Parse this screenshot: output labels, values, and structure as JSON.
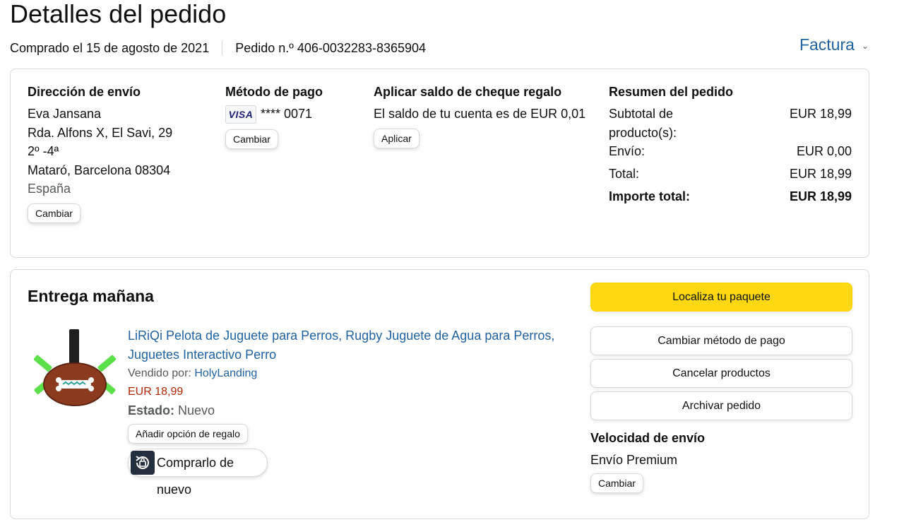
{
  "page": {
    "title": "Detalles del pedido",
    "ordered_on": "Comprado el 15 de agosto de 2021",
    "order_number": "Pedido n.º 406-0032283-8365904",
    "invoice_label": "Factura"
  },
  "shipping_address": {
    "title": "Dirección de envío",
    "lines": [
      "Eva Jansana",
      "Rda. Alfons X, El Savi, 29",
      "2º -4ª",
      "Mataró, Barcelona 08304"
    ],
    "country": "España",
    "change_label": "Cambiar"
  },
  "payment_method": {
    "title": "Método de pago",
    "card_brand": "VISA",
    "card_number": "**** 0071",
    "change_label": "Cambiar"
  },
  "gift_balance": {
    "title": "Aplicar saldo de cheque regalo",
    "balance_text": "El saldo de tu cuenta es de EUR 0,01",
    "apply_label": "Aplicar"
  },
  "order_summary": {
    "title": "Resumen del pedido",
    "subtotal_label": "Subtotal de producto(s):",
    "subtotal_value": "EUR 18,99",
    "shipping_label": "Envío:",
    "shipping_value": "EUR 0,00",
    "total_label": "Total:",
    "total_value": "EUR 18,99",
    "grand_total_label": "Importe total:",
    "grand_total_value": "EUR 18,99"
  },
  "delivery": {
    "title": "Entrega mañana",
    "product": {
      "title": "LiRiQi Pelota de Juguete para Perros, Rugby Juguete de Agua para Perros, Juguetes Interactivo Perro",
      "sold_by_label": "Vendido por:",
      "seller": "HolyLanding",
      "price": "EUR 18,99",
      "state_label": "Estado:",
      "state_value": "Nuevo",
      "gift_option_label": "Añadir opción de regalo",
      "buy_again_label": "Comprarlo de nuevo"
    },
    "actions": {
      "track": "Localiza tu paquete",
      "change_payment": "Cambiar método de pago",
      "cancel": "Cancelar productos",
      "archive": "Archivar pedido"
    },
    "shipping_speed_title": "Velocidad de envío",
    "shipping_speed_value": "Envío Premium",
    "shipping_speed_change": "Cambiar"
  },
  "colors": {
    "link": "#2162a1",
    "price": "#b12704",
    "primary_button": "#ffd814",
    "border": "#d5d9d9"
  }
}
